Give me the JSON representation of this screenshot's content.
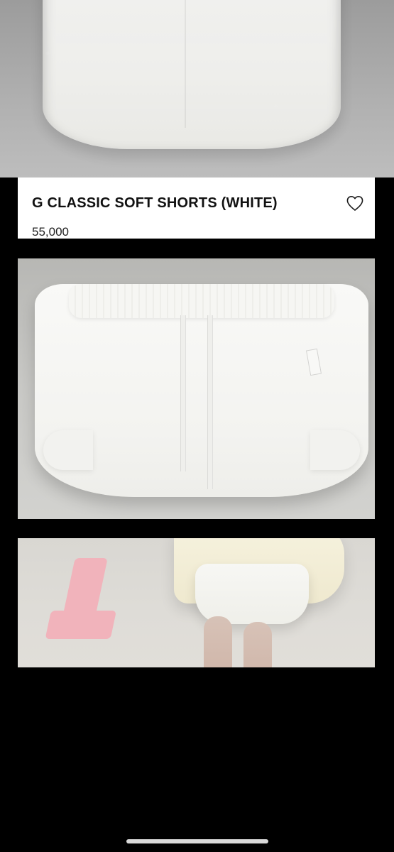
{
  "product": {
    "title": "G CLASSIC SOFT SHORTS (WHITE)",
    "price": "55,000"
  },
  "icons": {
    "favorite": "heart-outline-icon"
  },
  "colors": {
    "background": "#000000",
    "card": "#ffffff",
    "title": "#111111",
    "accent_pink": "#f1b3bb"
  }
}
